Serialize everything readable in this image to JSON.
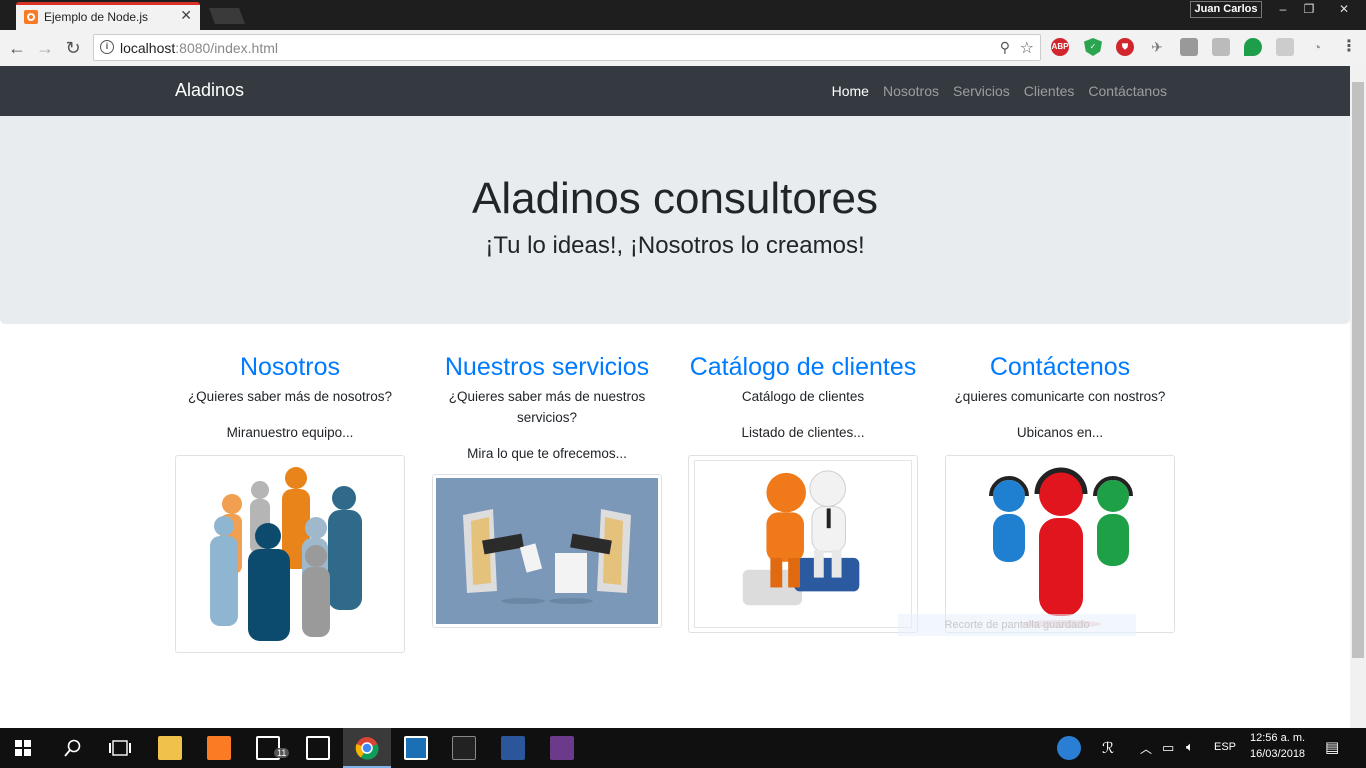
{
  "browser": {
    "tab_title": "Ejemplo de Node.js",
    "profile_name": "Juan Carlos",
    "url_host": "localhost",
    "url_rest": ":8080/index.html"
  },
  "navbar": {
    "brand": "Aladinos",
    "links": [
      "Home",
      "Nosotros",
      "Servicios",
      "Clientes",
      "Contáctanos"
    ],
    "active": "Home"
  },
  "hero": {
    "title": "Aladinos consultores",
    "subtitle": "¡Tu lo ideas!, ¡Nosotros lo creamos!"
  },
  "columns": [
    {
      "heading": "Nosotros",
      "question": "¿Quieres saber más de nosotros?",
      "sub": "Miranuestro equipo..."
    },
    {
      "heading": "Nuestros servicios",
      "question": "¿Quieres saber más de nuestros servicios?",
      "sub": "Mira lo que te ofrecemos..."
    },
    {
      "heading": "Catálogo de clientes",
      "question": "Catálogo de clientes",
      "sub": "Listado de clientes..."
    },
    {
      "heading": "Contáctenos",
      "question": "¿quieres comunicarte con nostros?",
      "sub": "Ubicanos en..."
    }
  ],
  "toast": "Recorte de pantalla guardado",
  "taskbar": {
    "mail_badge": "11",
    "language": "ESP",
    "time": "12:56 a. m.",
    "date": "16/03/2018"
  },
  "colors": {
    "navbar_bg": "#343a40",
    "jumbotron_bg": "#e9ecef",
    "link_blue": "#007bff"
  }
}
